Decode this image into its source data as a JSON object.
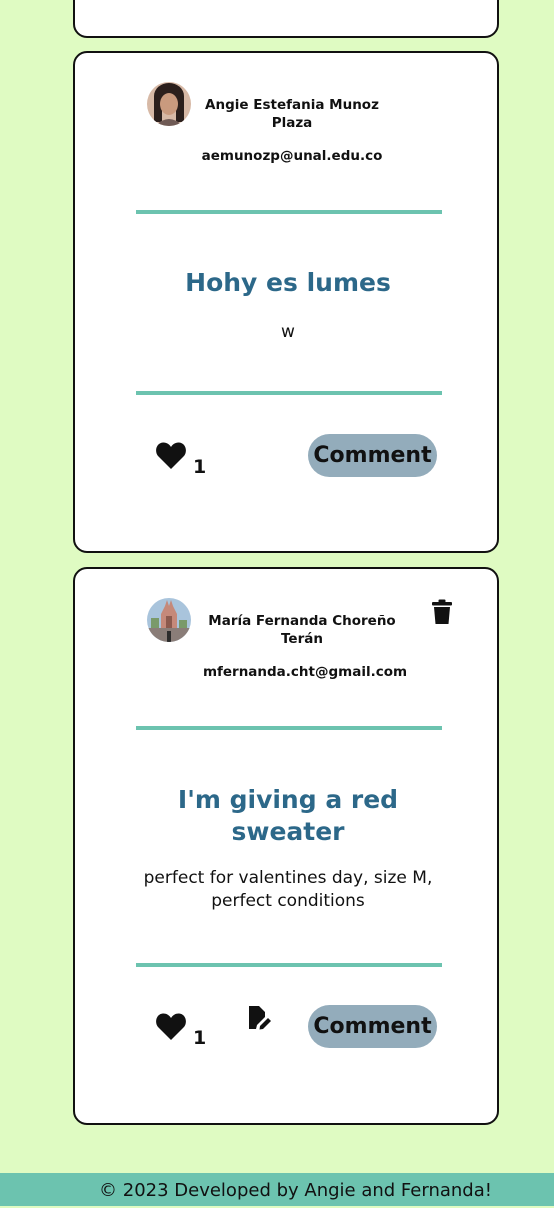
{
  "posts": [
    {
      "author": "Angie Estefania Munoz Plaza",
      "email": "aemunozp@unal.edu.co",
      "title": "Hohy es lumes",
      "description": "w",
      "likes": "1",
      "comment_label": "Comment",
      "icons": {
        "like": "heart-icon"
      }
    },
    {
      "author": "María Fernanda Choreño Terán",
      "email": "mfernanda.cht@gmail.com",
      "title": "I'm giving a red sweater",
      "description": "perfect for valentines day, size M, perfect conditions",
      "likes": "1",
      "comment_label": "Comment",
      "icons": {
        "like": "heart-icon",
        "edit": "file-edit-icon",
        "delete": "trash-icon"
      }
    }
  ],
  "footer": {
    "text": "© 2023 Developed by Angie and Fernanda!"
  },
  "colors": {
    "background": "#dffbc2",
    "accent": "#6cc3af",
    "title": "#2c6889",
    "button": "#93acbb"
  }
}
